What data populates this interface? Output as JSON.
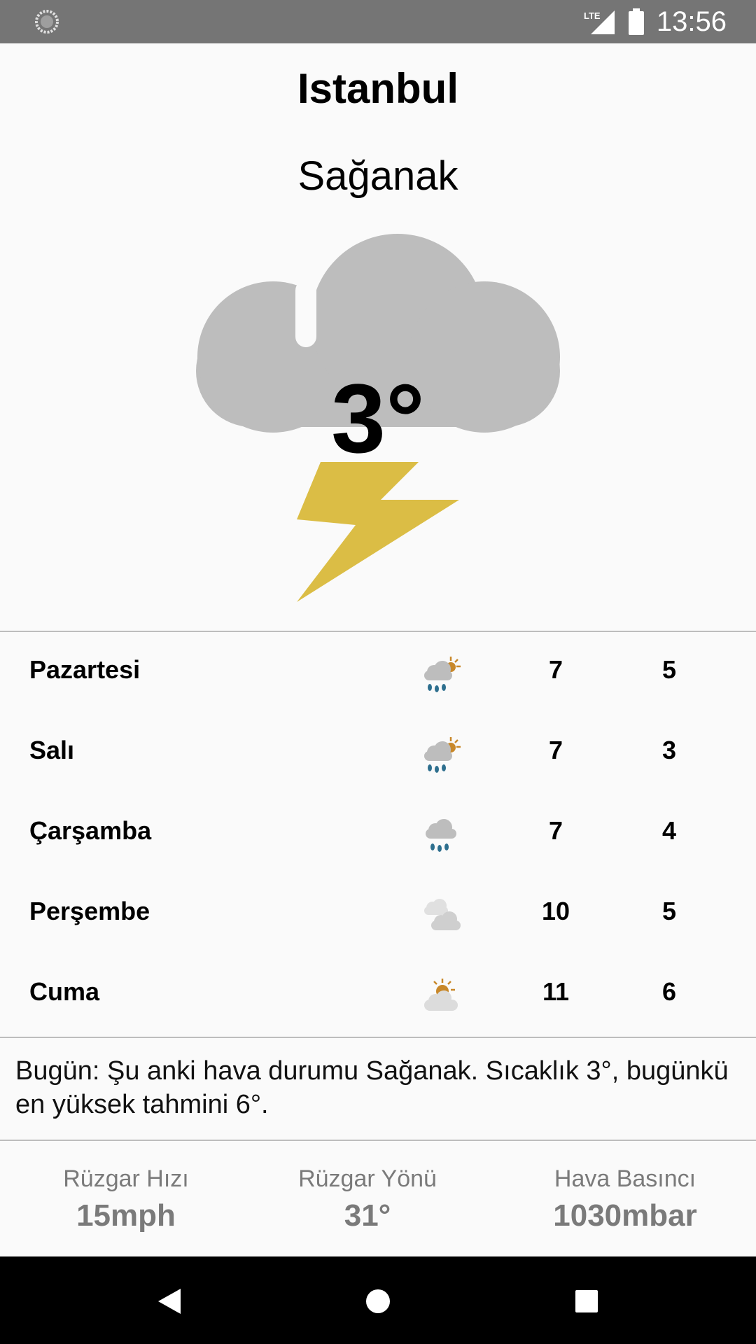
{
  "status_bar": {
    "time": "13:56",
    "network": "LTE",
    "icons": [
      "sync-icon",
      "lte-signal-icon",
      "battery-icon"
    ]
  },
  "header": {
    "city": "Istanbul",
    "condition": "Sağanak",
    "temperature": "3°",
    "icon": "thunderstorm-icon"
  },
  "forecast": [
    {
      "day": "Pazartesi",
      "icon": "rain-sun-icon",
      "high": "7",
      "low": "5"
    },
    {
      "day": "Salı",
      "icon": "rain-sun-icon",
      "high": "7",
      "low": "3"
    },
    {
      "day": "Çarşamba",
      "icon": "rain-icon",
      "high": "7",
      "low": "4"
    },
    {
      "day": "Perşembe",
      "icon": "cloudy-icon",
      "high": "10",
      "low": "5"
    },
    {
      "day": "Cuma",
      "icon": "partly-cloudy-icon",
      "high": "11",
      "low": "6"
    }
  ],
  "summary": "Bugün: Şu anki hava durumu Sağanak. Sıcaklık 3°, bugünkü en yüksek tahmini 6°.",
  "stats": {
    "wind_speed": {
      "label": "Rüzgar Hızı",
      "value": "15mph"
    },
    "wind_direction": {
      "label": "Rüzgar Yönü",
      "value": "31°"
    },
    "pressure": {
      "label": "Hava Basıncı",
      "value": "1030mbar"
    }
  },
  "nav": [
    "back-icon",
    "home-icon",
    "recents-icon"
  ],
  "colors": {
    "status_bar": "#757575",
    "cloud": "#bdbdbd",
    "bolt": "#dbbd45",
    "sun": "#c8882a",
    "rain": "#2e6f8e",
    "divider": "#bdbdbd"
  }
}
